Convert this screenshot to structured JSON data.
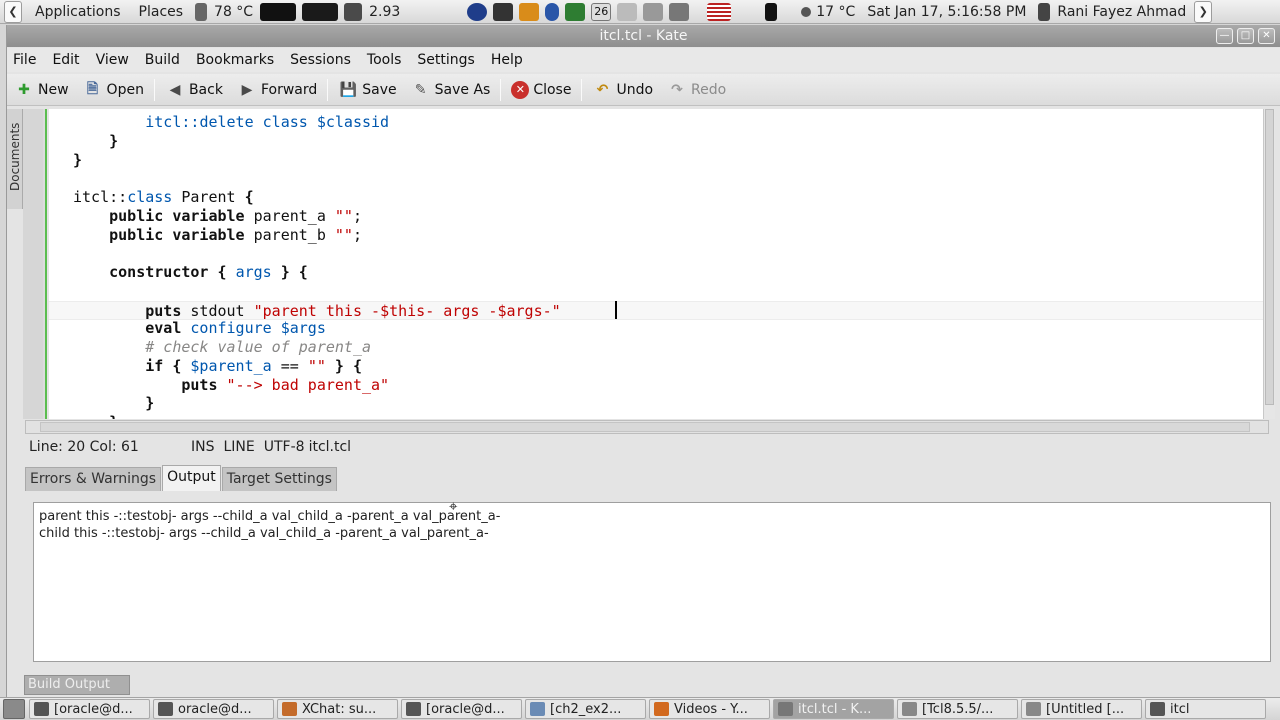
{
  "top_panel": {
    "menus": [
      "Applications",
      "Places"
    ],
    "temperature_cpu": "78 °C",
    "load": "2.93",
    "weather": "17 °C",
    "clock": "Sat Jan 17,  5:16:58 PM",
    "user": "Rani Fayez Ahmad",
    "tray_icons": [
      "firefox-icon",
      "terminal-icon",
      "tools-icon",
      "bluetooth-icon",
      "network-icon",
      "calendar-icon",
      "system-icon",
      "volume-icon",
      "clipboard-icon",
      "us-flag-icon",
      "bluetooth-icon"
    ],
    "calendar_day": "26"
  },
  "window": {
    "title": "itcl.tcl - Kate",
    "buttons": [
      "minimize",
      "maximize",
      "close"
    ]
  },
  "menubar": [
    "File",
    "Edit",
    "View",
    "Build",
    "Bookmarks",
    "Sessions",
    "Tools",
    "Settings",
    "Help"
  ],
  "toolbar": {
    "new": "New",
    "open": "Open",
    "back": "Back",
    "forward": "Forward",
    "save": "Save",
    "save_as": "Save As",
    "close": "Close",
    "undo": "Undo",
    "redo": "Redo"
  },
  "sidebar": {
    "documents_tab": "Documents"
  },
  "editor": {
    "current_line_index": 8,
    "lines": [
      [
        {
          "t": "        itcl::",
          "c": "fn"
        },
        {
          "t": "delete",
          "c": "fn"
        },
        {
          "t": " class ",
          "c": "fn"
        },
        {
          "t": "$classid",
          "c": "var"
        }
      ],
      [
        {
          "t": "    }",
          "c": "kw"
        }
      ],
      [
        {
          "t": "}",
          "c": "kw"
        }
      ],
      [
        {
          "t": "",
          "c": ""
        }
      ],
      [
        {
          "t": "itcl::",
          "c": ""
        },
        {
          "t": "class",
          "c": "fn"
        },
        {
          "t": " Parent ",
          "c": ""
        },
        {
          "t": "{",
          "c": "kw"
        }
      ],
      [
        {
          "t": "    public variable",
          "c": "kw"
        },
        {
          "t": " parent_a ",
          "c": ""
        },
        {
          "t": "\"\"",
          "c": "str"
        },
        {
          "t": ";",
          "c": ""
        }
      ],
      [
        {
          "t": "    public variable",
          "c": "kw"
        },
        {
          "t": " parent_b ",
          "c": ""
        },
        {
          "t": "\"\"",
          "c": "str"
        },
        {
          "t": ";",
          "c": ""
        }
      ],
      [
        {
          "t": "",
          "c": ""
        }
      ],
      [
        {
          "t": "    constructor { ",
          "c": "kw"
        },
        {
          "t": "args",
          "c": "fn"
        },
        {
          "t": " } {",
          "c": "kw"
        }
      ],
      [
        {
          "t": "",
          "c": ""
        }
      ],
      [
        {
          "t": "        puts",
          "c": "kw"
        },
        {
          "t": " stdout ",
          "c": ""
        },
        {
          "t": "\"parent this -",
          "c": "str"
        },
        {
          "t": "$this",
          "c": "str"
        },
        {
          "t": "- args -",
          "c": "str"
        },
        {
          "t": "$args",
          "c": "str"
        },
        {
          "t": "-\"",
          "c": "str"
        }
      ],
      [
        {
          "t": "        eval",
          "c": "kw"
        },
        {
          "t": " configure ",
          "c": "fn"
        },
        {
          "t": "$args",
          "c": "var"
        }
      ],
      [
        {
          "t": "        # check value of parent_a",
          "c": "cm"
        }
      ],
      [
        {
          "t": "        if { ",
          "c": "kw"
        },
        {
          "t": "$parent_a",
          "c": "var"
        },
        {
          "t": " == ",
          "c": ""
        },
        {
          "t": "\"\"",
          "c": "str"
        },
        {
          "t": " } {",
          "c": "kw"
        }
      ],
      [
        {
          "t": "            puts",
          "c": "kw"
        },
        {
          "t": " ",
          "c": ""
        },
        {
          "t": "\"--> bad parent_a\"",
          "c": "str"
        }
      ],
      [
        {
          "t": "        }",
          "c": "kw"
        }
      ],
      [
        {
          "t": "    }",
          "c": "kw"
        }
      ]
    ]
  },
  "statusbar": {
    "line_col": "Line: 20 Col: 61",
    "mode": "INS",
    "selection": "LINE",
    "encoding": "UTF-8",
    "filename": "itcl.tcl"
  },
  "build_panel": {
    "tabs": [
      "Errors & Warnings",
      "Output",
      "Target Settings"
    ],
    "active_tab": "Output",
    "output_lines": [
      "parent this -::testobj- args --child_a val_child_a -parent_a val_parent_a-",
      "child this -::testobj- args --child_a val_child_a -parent_a val_parent_a-"
    ],
    "toggle_label": "Build Output"
  },
  "taskbar": [
    {
      "label": "[oracle@d...",
      "icon": "terminal-icon",
      "color": "#555555"
    },
    {
      "label": "oracle@d...",
      "icon": "terminal-icon",
      "color": "#555555"
    },
    {
      "label": "XChat: su...",
      "icon": "xchat-icon",
      "color": "#c46b2a"
    },
    {
      "label": "[oracle@d...",
      "icon": "terminal-icon",
      "color": "#555555"
    },
    {
      "label": "[ch2_ex2...",
      "icon": "image-icon",
      "color": "#6a8bb5"
    },
    {
      "label": "Videos - Y...",
      "icon": "firefox-icon",
      "color": "#d2691e"
    },
    {
      "label": "itcl.tcl - K...",
      "icon": "kate-icon",
      "color": "#777777",
      "active": true
    },
    {
      "label": "[Tcl8.5.5/...",
      "icon": "editor-icon",
      "color": "#888888"
    },
    {
      "label": "[Untitled [...",
      "icon": "drawing-icon",
      "color": "#888888"
    },
    {
      "label": "itcl",
      "icon": "folder-icon",
      "color": "#555555"
    }
  ],
  "colors": {
    "keyword": "#111111",
    "function": "#0057ae",
    "string": "#bf0303",
    "comment": "#888786",
    "modified_marker": "#5bbd4f"
  }
}
